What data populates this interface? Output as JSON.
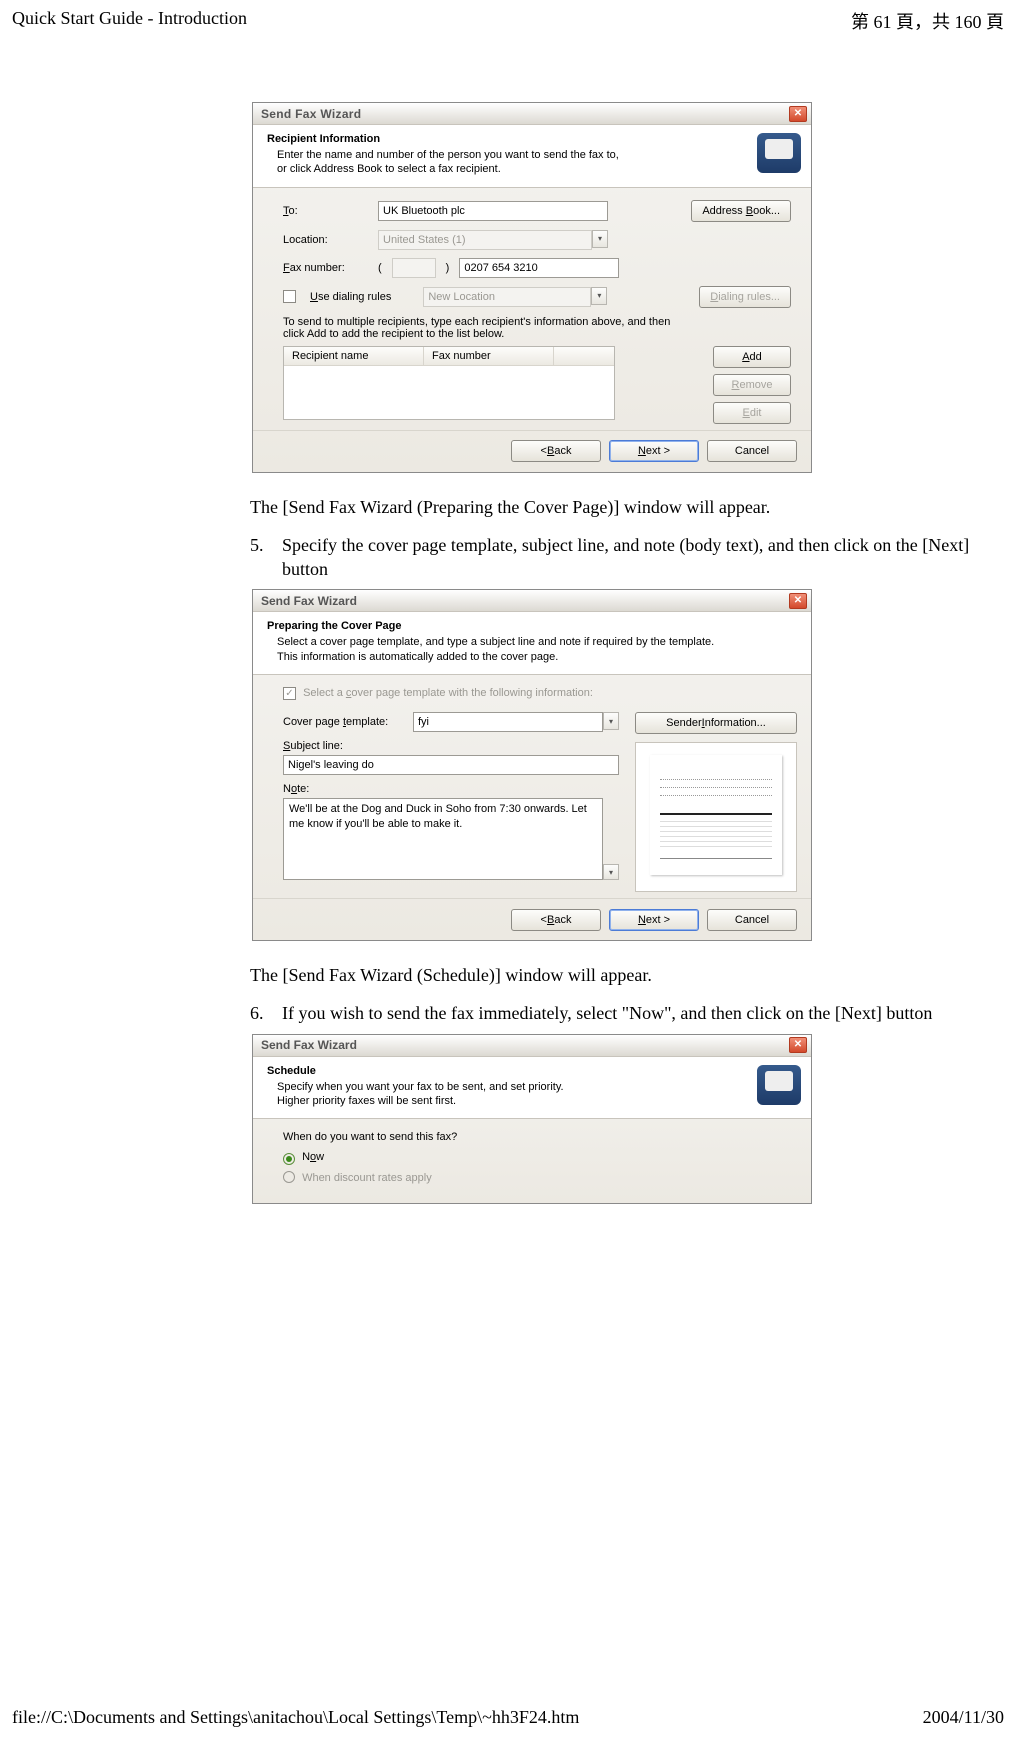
{
  "page": {
    "header_left": "Quick Start Guide - Introduction",
    "header_right": "第 61 頁，共 160 頁",
    "footer_left": "file://C:\\Documents and Settings\\anitachou\\Local Settings\\Temp\\~hh3F24.htm",
    "footer_right": "2004/11/30"
  },
  "text": {
    "after_img1": "The [Send Fax Wizard (Preparing the Cover Page)] window will appear.",
    "step5_num": "5.",
    "step5": "Specify the cover page template, subject line, and note (body text), and then click on the [Next] button",
    "after_img2": "The [Send Fax Wizard (Schedule)] window will appear.",
    "step6_num": "6.",
    "step6": "If you wish to send the fax immediately, select \"Now\", and then click on the [Next] button"
  },
  "wizard1": {
    "title": "Send Fax Wizard",
    "heading": "Recipient Information",
    "sub1": "Enter the name and number of the person you want to send the fax to,",
    "sub2": "or click Address Book to select a fax recipient.",
    "to_label": "To:",
    "to_value": "UK Bluetooth plc",
    "location_label": "Location:",
    "location_value": "United States (1)",
    "fax_label": "Fax number:",
    "fax_area": "",
    "fax_value": "0207 654 3210",
    "use_rules_label": "Use dialing rules",
    "new_location_value": "New Location",
    "address_book_btn": "Address Book...",
    "dialing_rules_btn": "Dialing rules...",
    "multi_line1": "To send to multiple recipients, type each recipient's information above, and then",
    "multi_line2": "click Add to add the recipient to the list below.",
    "col1": "Recipient name",
    "col2": "Fax number",
    "add_btn": "Add",
    "remove_btn": "Remove",
    "edit_btn": "Edit",
    "back_btn": "< Back",
    "next_btn": "Next >",
    "cancel_btn": "Cancel"
  },
  "wizard2": {
    "title": "Send Fax Wizard",
    "heading": "Preparing the Cover Page",
    "sub1": "Select a cover page template, and type a subject line and note if required by the template.",
    "sub2": "This information is automatically added to the cover page.",
    "select_cover_label": "Select a cover page template with the following information:",
    "template_label": "Cover page template:",
    "template_value": "fyi",
    "sender_btn": "Sender Information...",
    "subject_label": "Subject line:",
    "subject_value": "Nigel's leaving do",
    "note_label": "Note:",
    "note_value": "We'll be at the Dog and Duck in Soho from 7:30 onwards. Let me know if you'll be able to make it.",
    "back_btn": "< Back",
    "next_btn": "Next >",
    "cancel_btn": "Cancel"
  },
  "wizard3": {
    "title": "Send Fax Wizard",
    "heading": "Schedule",
    "sub1": "Specify when you want your fax to be sent, and set priority.",
    "sub2": "Higher priority faxes will be sent first.",
    "question": "When do you want to send this fax?",
    "opt_now": "Now",
    "opt_discount": "When discount rates apply"
  }
}
